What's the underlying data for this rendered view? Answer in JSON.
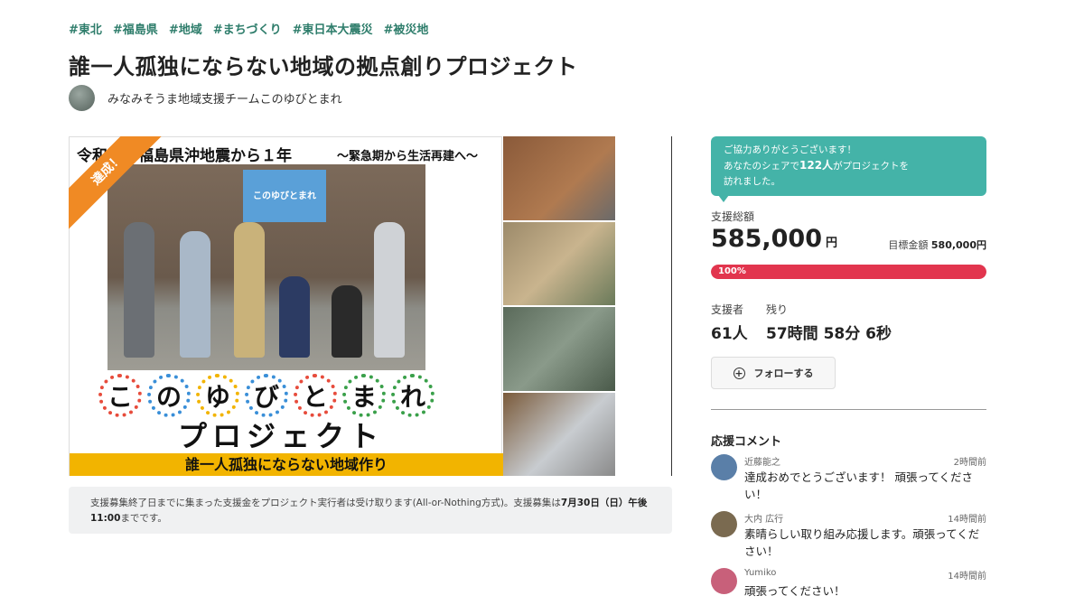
{
  "tags": [
    "#東北",
    "#福島県",
    "#地域",
    "#まちづくり",
    "#東日本大震災",
    "#被災地"
  ],
  "project": {
    "title": "誰一人孤独にならない地域の拠点創りプロジェクト",
    "owner": "みなみそうま地域支援チームこのゆびとまれ"
  },
  "hero": {
    "achieved_ribbon": "達成！",
    "heading": "令和　　福島県沖地震から１年",
    "subheading": "～緊急期から生活再建へ～",
    "sign_text": "このゆびとまれ",
    "logo_chars": [
      "こ",
      "の",
      "ゆ",
      "び",
      "と",
      "ま",
      "れ"
    ],
    "logo_ring_colors": [
      "#e74c3c",
      "#3a8fd8",
      "#f2b400",
      "#3a8fd8",
      "#e74c3c",
      "#3aa04a",
      "#3aa04a"
    ],
    "project_word": "プロジェクト",
    "band_text": "誰一人孤独にならない地域作り"
  },
  "notice": {
    "text_a": "支援募集終了日までに集まった支援金をプロジェクト実行者は受け取ります(All-or-Nothing方式)。支援募集は",
    "deadline": "7月30日（日）午後11:00",
    "text_b": "までです。"
  },
  "share": {
    "line1": "ご協力ありがとうございます！",
    "line2_a": "あなたのシェアで",
    "count": "122人",
    "line2_b": "がプロジェクトを",
    "line3": "訪れました。"
  },
  "funding": {
    "total_label": "支援総額",
    "total_value": "585,000",
    "currency": "円",
    "goal_label": "目標金額",
    "goal_value": "580,000円",
    "progress_percent": 100,
    "progress_label": "100%"
  },
  "stats": {
    "supporters_label": "支援者",
    "supporters_value": "61人",
    "remaining_label": "残り",
    "remaining_value": "57時間 58分 6秒"
  },
  "follow": {
    "label": "フォローする"
  },
  "comments": {
    "title": "応援コメント",
    "items": [
      {
        "name": "近藤能之",
        "time": "2時間前",
        "text": "達成おめでとうございます！ 頑張ってください！",
        "avatar_color": "#5a7fa8"
      },
      {
        "name": "大内 広行",
        "time": "14時間前",
        "text": "素晴らしい取り組み応援します。頑張ってください！",
        "avatar_color": "#7a6a50"
      },
      {
        "name": "Yumiko",
        "time": "14時間前",
        "text": "頑張ってください！",
        "avatar_color": "#c8607a"
      }
    ]
  },
  "colors": {
    "accent": "#44b3a8",
    "tag": "#2e7d6b",
    "progress": "#e2354e",
    "ribbon": "#f08a24",
    "band": "#f2b400"
  }
}
